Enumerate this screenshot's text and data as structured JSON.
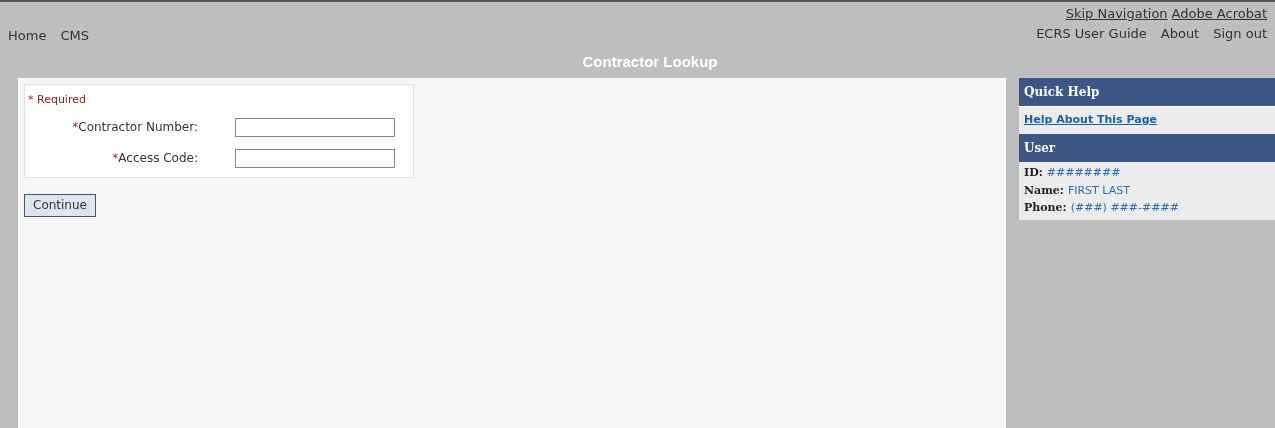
{
  "header": {
    "left_links": [
      "Home",
      "CMS"
    ],
    "top_links": [
      "Skip Navigation",
      "Adobe Acrobat"
    ],
    "right_links": [
      "ECRS User Guide",
      "About",
      "Sign out"
    ],
    "title": "Contractor Lookup"
  },
  "form": {
    "required_note": {
      "mark": "*",
      "text": "Required"
    },
    "fields": [
      {
        "mark": "*",
        "label": "Contractor Number:"
      },
      {
        "mark": "*",
        "label": "Access Code:"
      }
    ],
    "button": "Continue"
  },
  "sidebar": {
    "quick_help": {
      "title": "Quick Help",
      "link": "Help About This Page"
    },
    "user": {
      "title": "User",
      "rows": [
        {
          "label": "ID:",
          "value": "########"
        },
        {
          "label": "Name:",
          "value": "FIRST LAST"
        },
        {
          "label": "Phone:",
          "value": "(###) ###-####"
        }
      ]
    }
  }
}
